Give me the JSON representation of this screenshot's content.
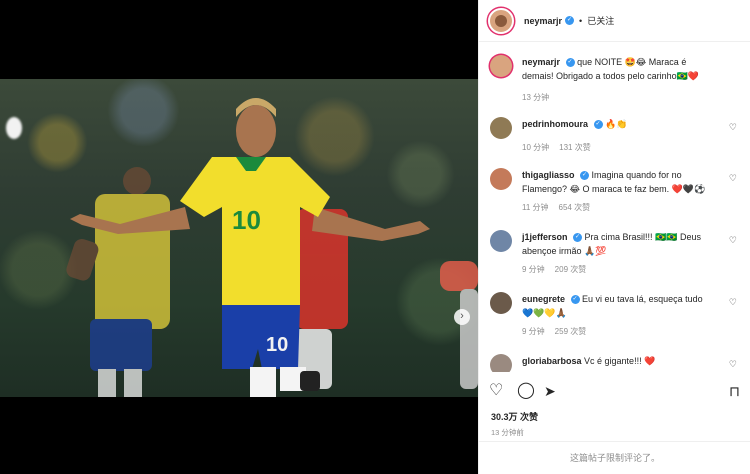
{
  "post": {
    "username": "neymarjr",
    "separator": "•",
    "follow_status": "已关注",
    "carousel": {
      "dot_count": 3,
      "active_index": 0
    }
  },
  "caption": {
    "username": "neymarjr",
    "text": "que NOITE 🤩😂 Maraca é demais! Obrigado a todos pelo carinho🇧🇷❤️",
    "time": "13 分钟"
  },
  "comments": [
    {
      "username": "pedrinhomoura",
      "text": "🔥👏",
      "time": "",
      "likes": ""
    },
    {
      "username": "",
      "text": "",
      "time": "10 分钟",
      "likes": "131 次赞"
    },
    {
      "username": "thigagliasso",
      "text": "Imagina quando for no Flamengo? 😂 O maraca te faz bem. ❤️🖤⚽",
      "time": "11 分钟",
      "likes": "654 次赞"
    },
    {
      "username": "j1jefferson",
      "text": "Pra cima Brasil!!! 🇧🇷🇧🇷 Deus abençoe irmão 🙏🏾💯",
      "time": "9 分钟",
      "likes": "209 次赞"
    },
    {
      "username": "eunegrete",
      "text": "Eu vi eu tava lá, esqueça tudo 💙💚💛🙏🏾",
      "time": "9 分钟",
      "likes": "259 次赞"
    },
    {
      "username": "gloriabarbosa",
      "text": "Vc é gigante!!! ❤️",
      "time": "",
      "likes": ""
    }
  ],
  "stats": {
    "likes": "30.3万 次赞",
    "posted": "13 分钟前"
  },
  "footer": {
    "notice": "这篇帖子限制评论了。"
  },
  "colors": {
    "verified_blue": "#3897f0",
    "secondary_text": "#8e8e8e"
  },
  "icons": {
    "like": "heart-icon",
    "comment": "comment-icon",
    "share": "share-icon",
    "save": "bookmark-icon",
    "next": "chevron-right-icon"
  }
}
